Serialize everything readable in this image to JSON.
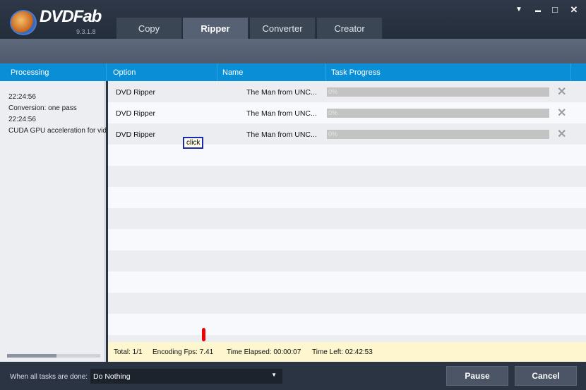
{
  "app": {
    "brand": "DVDFab",
    "version": "9.3.1.8"
  },
  "tabs": [
    "Copy",
    "Ripper",
    "Converter",
    "Creator"
  ],
  "active_tab": "Ripper",
  "window_controls": {
    "menu": "▼",
    "minimize": "▬",
    "maximize": "□",
    "close": "✕"
  },
  "columns": {
    "processing": "Processing",
    "option": "Option",
    "name": "Name",
    "progress": "Task Progress"
  },
  "log": [
    "22:24:56",
    "Conversion: one pass",
    "22:24:56",
    "CUDA GPU acceleration for vid"
  ],
  "tasks": [
    {
      "option": "DVD Ripper",
      "name": "The Man from UNC...",
      "progress": "0%"
    },
    {
      "option": "DVD Ripper",
      "name": "The Man from UNC...",
      "progress": "0%"
    },
    {
      "option": "DVD Ripper",
      "name": "The Man from UNC...",
      "progress": "0%"
    }
  ],
  "tooltip": "click",
  "status": {
    "total": "Total: 1/1",
    "fps": "Encoding Fps: 7.41",
    "elapsed": "Time Elapsed: 00:00:07",
    "left": "Time Left: 02:42:53"
  },
  "footer": {
    "when_done_label": "When all tasks are done:",
    "when_done_value": "Do Nothing",
    "pause": "Pause",
    "cancel": "Cancel"
  }
}
